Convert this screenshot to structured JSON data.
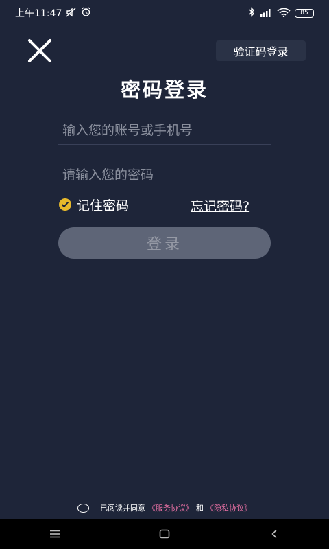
{
  "status_bar": {
    "time": "上午11:47",
    "battery": "85",
    "left_icons": [
      "mute-icon",
      "alarm-icon"
    ],
    "right_icons": [
      "bluetooth-icon",
      "signal-icon",
      "wifi-icon"
    ]
  },
  "header": {
    "close_icon": "close-icon",
    "switch_label": "验证码登录",
    "title": "密码登录"
  },
  "form": {
    "account_placeholder": "输入您的账号或手机号",
    "password_placeholder": "请输入您的密码",
    "remember_label": "记住密码",
    "remember_checked": true,
    "forgot_label": "忘记密码?",
    "login_label": "登录"
  },
  "agreement": {
    "prefix": "已阅读并同意",
    "service_link": "《服务协议》",
    "and": "和",
    "privacy_link": "《隐私协议》",
    "checked": false
  },
  "nav": {
    "icons": [
      "menu-icon",
      "home-icon",
      "back-icon"
    ]
  },
  "colors": {
    "background": "#1e2539",
    "accent": "#e7b92b",
    "link": "#e56fa2",
    "button_disabled": "#5e6577"
  }
}
